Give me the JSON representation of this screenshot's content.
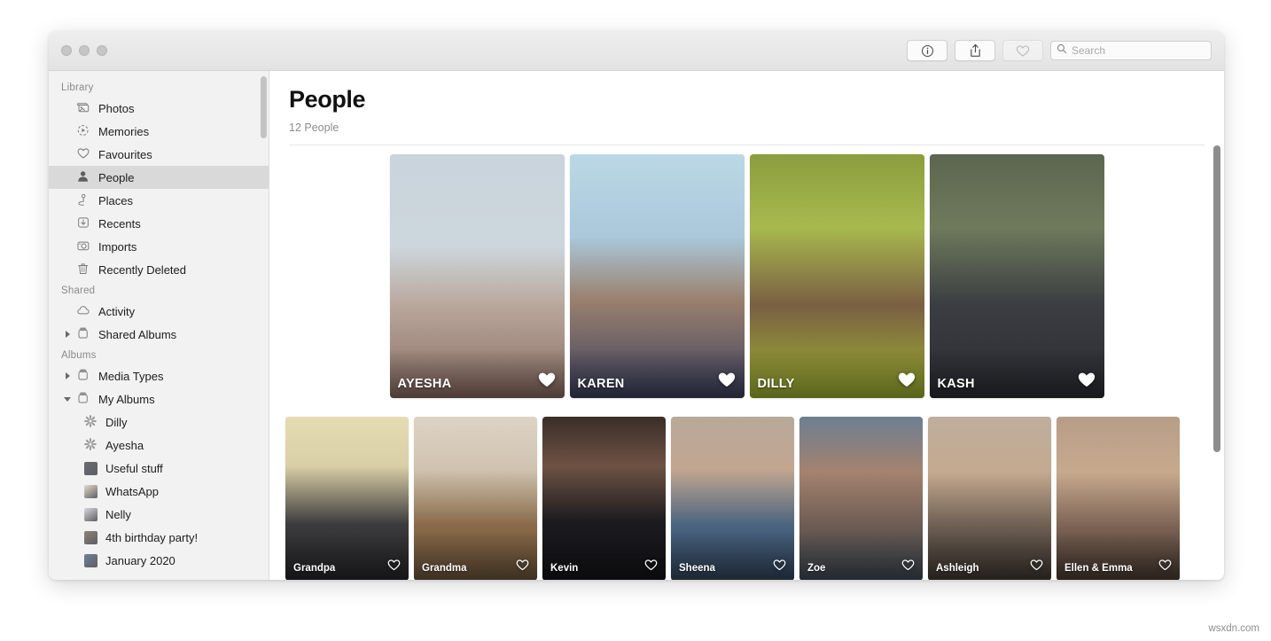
{
  "window": {
    "traffic_lights": [
      "close",
      "minimize",
      "zoom"
    ]
  },
  "toolbar": {
    "info_button": "info-icon",
    "share_button": "share-icon",
    "favourite_button": "heart-icon",
    "search": {
      "placeholder": "Search",
      "value": "",
      "icon": "search-icon"
    }
  },
  "sidebar": {
    "sections": [
      {
        "title": "Library",
        "items": [
          {
            "label": "Photos",
            "icon": "photos-icon",
            "selected": false,
            "disclosure": "none"
          },
          {
            "label": "Memories",
            "icon": "memories-icon",
            "selected": false,
            "disclosure": "none"
          },
          {
            "label": "Favourites",
            "icon": "heart-icon",
            "selected": false,
            "disclosure": "none"
          },
          {
            "label": "People",
            "icon": "person-icon",
            "selected": true,
            "disclosure": "none"
          },
          {
            "label": "Places",
            "icon": "places-pin-icon",
            "selected": false,
            "disclosure": "none"
          },
          {
            "label": "Recents",
            "icon": "recents-download-icon",
            "selected": false,
            "disclosure": "none"
          },
          {
            "label": "Imports",
            "icon": "imports-camera-icon",
            "selected": false,
            "disclosure": "none"
          },
          {
            "label": "Recently Deleted",
            "icon": "trash-icon",
            "selected": false,
            "disclosure": "none"
          }
        ]
      },
      {
        "title": "Shared",
        "items": [
          {
            "label": "Activity",
            "icon": "cloud-icon",
            "selected": false,
            "disclosure": "none"
          },
          {
            "label": "Shared Albums",
            "icon": "albums-icon",
            "selected": false,
            "disclosure": "right"
          }
        ]
      },
      {
        "title": "Albums",
        "items": [
          {
            "label": "Media Types",
            "icon": "albums-icon",
            "selected": false,
            "disclosure": "right"
          },
          {
            "label": "My Albums",
            "icon": "albums-icon",
            "selected": false,
            "disclosure": "down"
          },
          {
            "label": "Dilly",
            "icon": "gear-icon",
            "selected": false,
            "disclosure": "none",
            "indent": true
          },
          {
            "label": "Ayesha",
            "icon": "gear-icon",
            "selected": false,
            "disclosure": "none",
            "indent": true
          },
          {
            "label": "Useful stuff",
            "icon": "thumb-icon",
            "selected": false,
            "disclosure": "none",
            "indent": true,
            "thumb_color": "#6a6a70"
          },
          {
            "label": "WhatsApp",
            "icon": "thumb-icon",
            "selected": false,
            "disclosure": "none",
            "indent": true,
            "thumb_color": "#e4ddc9"
          },
          {
            "label": "Nelly",
            "icon": "thumb-icon",
            "selected": false,
            "disclosure": "none",
            "indent": true,
            "thumb_color": "#d8d8de"
          },
          {
            "label": "4th birthday party!",
            "icon": "thumb-icon",
            "selected": false,
            "disclosure": "none",
            "indent": true,
            "thumb_color": "#8f8273"
          },
          {
            "label": "January 2020",
            "icon": "thumb-icon",
            "selected": false,
            "disclosure": "none",
            "indent": true,
            "thumb_color": "#6f8296"
          }
        ]
      }
    ],
    "scrollbar": {
      "visible": true
    }
  },
  "main": {
    "title": "People",
    "subtitle": "12 People",
    "rows": [
      {
        "size": "large",
        "tiles": [
          {
            "name": "AYESHA",
            "favourite": true,
            "photo": "baby-girl-pink-outdoors"
          },
          {
            "name": "KAREN",
            "favourite": true,
            "photo": "woman-sunglasses-seaside"
          },
          {
            "name": "DILLY",
            "favourite": true,
            "photo": "baby-brown-top-green-highchair"
          },
          {
            "name": "KASH",
            "favourite": true,
            "photo": "man-dark-coat-park"
          }
        ]
      },
      {
        "size": "small",
        "tiles": [
          {
            "name": "Grandpa",
            "favourite": false,
            "photo": "elderly-man-suit-tie"
          },
          {
            "name": "Grandma",
            "favourite": false,
            "photo": "elderly-woman-glasses-scarf"
          },
          {
            "name": "Kevin",
            "favourite": false,
            "photo": "man-black-band-tshirt"
          },
          {
            "name": "Sheena",
            "favourite": false,
            "photo": "woman-denim-jacket-smiling"
          },
          {
            "name": "Zoe",
            "favourite": false,
            "photo": "woman-glitter-face-paint"
          },
          {
            "name": "Ashleigh",
            "favourite": false,
            "photo": "woman-patterned-top-smiling"
          },
          {
            "name": "Ellen & Emma",
            "favourite": false,
            "photo": "woman-holding-baby"
          }
        ]
      },
      {
        "size": "third",
        "tiles": [
          {
            "name": "",
            "favourite": false,
            "photo": "partial-row-top-edge-1"
          },
          {
            "name": "",
            "favourite": false,
            "photo": "partial-row-top-edge-2"
          },
          {
            "name": "",
            "favourite": false,
            "photo": "partial-row-top-edge-3"
          },
          {
            "name": "",
            "favourite": false,
            "photo": "partial-row-top-edge-4"
          },
          {
            "name": "",
            "favourite": false,
            "photo": "partial-row-top-edge-5"
          },
          {
            "name": "",
            "favourite": false,
            "photo": "partial-row-top-edge-6"
          },
          {
            "name": "",
            "favourite": false,
            "photo": "partial-row-top-edge-7"
          }
        ]
      }
    ],
    "scrollbar": {
      "visible": true
    }
  },
  "watermark": "wsxdn.com"
}
